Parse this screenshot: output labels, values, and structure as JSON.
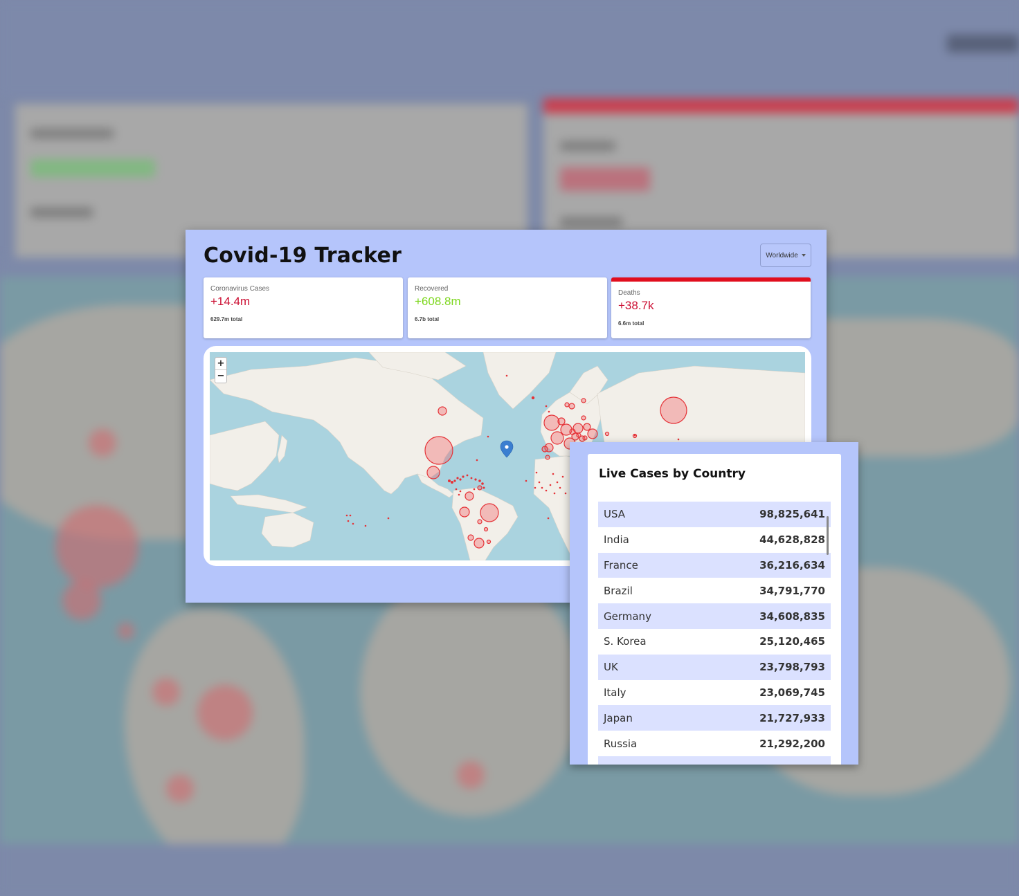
{
  "app": {
    "title": "Covid-19 Tracker",
    "country_select": "Worldwide"
  },
  "stats": [
    {
      "title": "Coronavirus Cases",
      "value": "+14.4m",
      "total": "629.7m total",
      "color": "#cc1034"
    },
    {
      "title": "Recovered",
      "value": "+608.8m",
      "total": "6.7b total",
      "color": "#7dd71d"
    },
    {
      "title": "Deaths",
      "value": "+38.7k",
      "total": "6.6m total",
      "color": "#cc1034",
      "selected": true
    }
  ],
  "map": {
    "zoom_in": "+",
    "zoom_out": "−",
    "bubble_color": "#e0262b"
  },
  "live_cases": {
    "title": "Live Cases by Country",
    "rows": [
      {
        "country": "USA",
        "cases": "98,825,641"
      },
      {
        "country": "India",
        "cases": "44,628,828"
      },
      {
        "country": "France",
        "cases": "36,216,634"
      },
      {
        "country": "Brazil",
        "cases": "34,791,770"
      },
      {
        "country": "Germany",
        "cases": "34,608,835"
      },
      {
        "country": "S. Korea",
        "cases": "25,120,465"
      },
      {
        "country": "UK",
        "cases": "23,798,793"
      },
      {
        "country": "Italy",
        "cases": "23,069,745"
      },
      {
        "country": "Japan",
        "cases": "21,727,933"
      },
      {
        "country": "Russia",
        "cases": "21,292,200"
      }
    ]
  },
  "colors": {
    "panel_bg": "#b5c5fb",
    "accent_red": "#e10e1e",
    "row_stripe": "#dbe1ff"
  }
}
